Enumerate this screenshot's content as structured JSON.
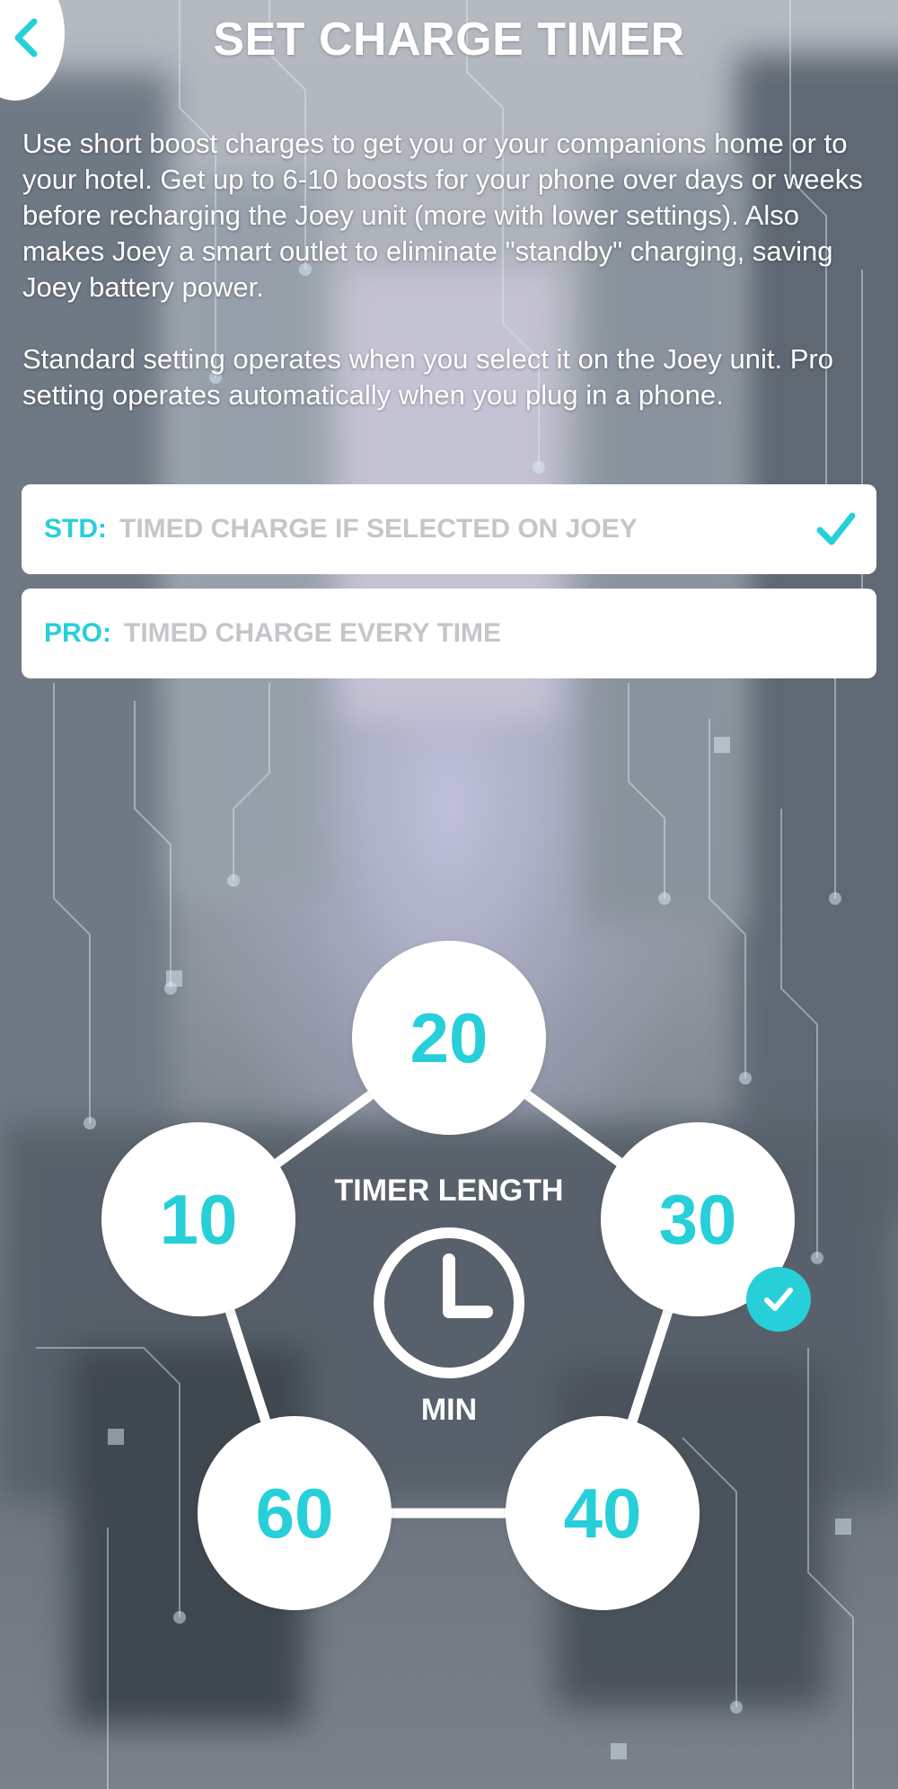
{
  "header": {
    "title": "SET CHARGE TIMER",
    "back_icon": "chevron-left-icon"
  },
  "description": {
    "paragraph1": "Use short boost charges to get you or your companions home or to your hotel. Get up to 6-10 boosts for your phone over days or weeks before recharging the Joey unit (more with lower settings). Also makes Joey a smart outlet to eliminate \"standby\" charging, saving Joey battery power.",
    "paragraph2": "Standard setting operates when you select it on the Joey unit. Pro setting operates automatically when you plug in a phone."
  },
  "options": {
    "std": {
      "code": "STD:",
      "text": "TIMED CHARGE IF SELECTED ON JOEY",
      "selected": true
    },
    "pro": {
      "code": "PRO:",
      "text": "TIMED CHARGE EVERY TIME",
      "selected": false
    }
  },
  "timer": {
    "label": "TIMER LENGTH",
    "unit": "MIN",
    "center_icon": "clock-icon",
    "options": [
      "20",
      "10",
      "30",
      "60",
      "40"
    ],
    "selected": "30"
  },
  "colors": {
    "accent": "#27cfd9",
    "card": "#ffffff",
    "option_text": "#c4c6c9"
  }
}
